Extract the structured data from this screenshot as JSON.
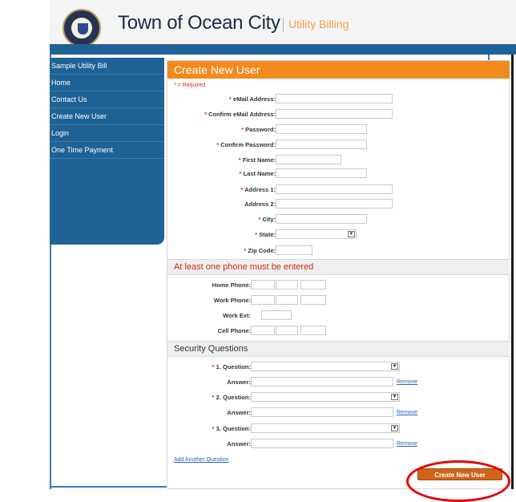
{
  "header": {
    "town_name": "Town of Ocean City",
    "subtitle": "Utility Billing"
  },
  "sidebar": {
    "items": [
      {
        "label": "Sample Utility Bill"
      },
      {
        "label": "Home"
      },
      {
        "label": "Contact Us"
      },
      {
        "label": "Create New User"
      },
      {
        "label": "Login"
      },
      {
        "label": "One Time Payment"
      }
    ]
  },
  "form": {
    "title": "Create New User",
    "required_note": "* = Required",
    "fields": [
      {
        "label": "eMail Address:",
        "required": true
      },
      {
        "label": "Confirm eMail Address:",
        "required": true
      },
      {
        "label": "Password:",
        "required": true
      },
      {
        "label": "Confirm Password:",
        "required": true
      },
      {
        "label": "First Name:",
        "required": true
      },
      {
        "label": "Last Name:",
        "required": true
      },
      {
        "label": "Address 1:",
        "required": true
      },
      {
        "label": "Address 2:",
        "required": false
      },
      {
        "label": "City:",
        "required": true
      },
      {
        "label": "State:",
        "required": true
      },
      {
        "label": "Zip Code:",
        "required": true
      }
    ],
    "phone_section": {
      "title": "At least one phone must be entered",
      "home": "Home Phone:",
      "work": "Work Phone:",
      "work_ext": "Work Ext:",
      "cell": "Cell Phone:"
    },
    "security_section": {
      "title": "Security Questions",
      "questions": [
        {
          "label": "1. Question:"
        },
        {
          "label": "2. Question:"
        },
        {
          "label": "3. Question:"
        }
      ],
      "answer_label": "Answer:",
      "remove_label": "Remove",
      "add_label": "Add Another Question"
    },
    "submit_label": "Create New User",
    "star": "*"
  },
  "icons": {
    "select_arrow": "chevron-down-icon"
  },
  "colors": {
    "nav_blue": "#1e6296",
    "orange": "#f28a1d",
    "required_red": "#d22222",
    "highlight_circle": "#e60000"
  }
}
